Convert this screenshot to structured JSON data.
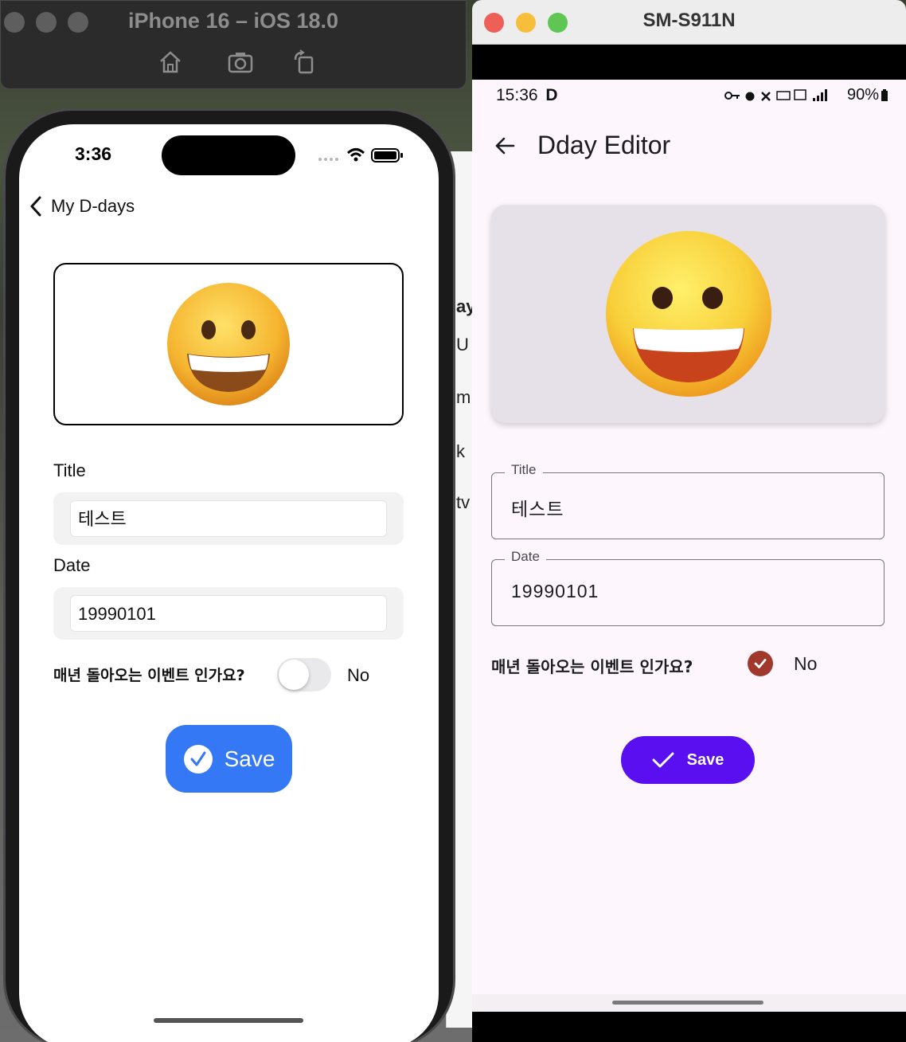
{
  "ios_simulator": {
    "window_title": "iPhone 16 – iOS 18.0",
    "status_time": "3:36",
    "nav_back_label": "My D-days",
    "emoji": "😀",
    "title_label": "Title",
    "title_value": "테스트",
    "date_label": "Date",
    "date_value": "19990101",
    "recurring_question": "매년 돌아오는 이벤트 인가요?",
    "recurring_state": "No",
    "recurring_on": false,
    "save_label": "Save",
    "accent_color": "#3478f6",
    "toolbar_icons": [
      "home-icon",
      "screenshot-icon",
      "rotate-icon"
    ]
  },
  "android_emulator": {
    "window_title": "SM-S911N",
    "status_time": "15:36",
    "status_carrier_glyph": "D",
    "battery": "90%",
    "app_title": "Dday Editor",
    "emoji": "😀",
    "title_label": "Title",
    "title_value": "테스트",
    "date_label": "Date",
    "date_value": "19990101",
    "recurring_question": "매년 돌아오는 이벤트 인가요?",
    "recurring_state": "No",
    "recurring_checked": true,
    "save_label": "Save",
    "accent_color": "#5a0ff0",
    "check_color": "#a0392c"
  },
  "background_fragments": [
    "ay",
    "U",
    "m",
    "k",
    "tv"
  ]
}
